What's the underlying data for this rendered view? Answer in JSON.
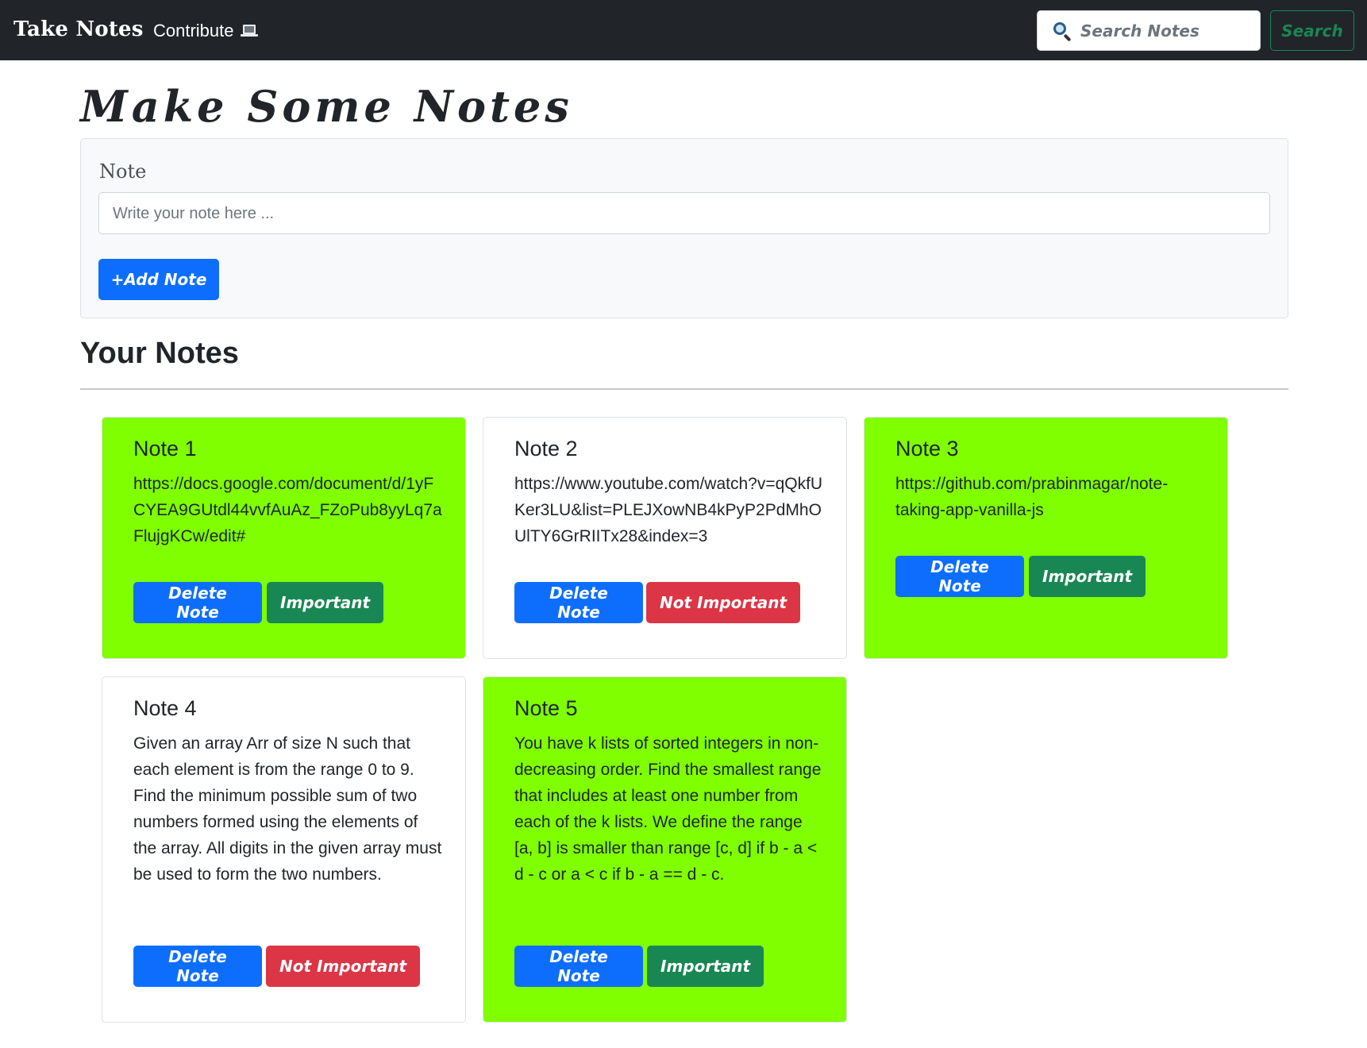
{
  "navbar": {
    "brand": "Take Notes",
    "contribute_label": "Contribute",
    "contribute_icon": "laptop-icon",
    "search_icon": "search-icon",
    "search_placeholder": "Search Notes",
    "search_button": "Search"
  },
  "main": {
    "title": "Make Some Notes",
    "form": {
      "label": "Note",
      "placeholder": "Write your note here ...",
      "add_button": "+Add Note"
    },
    "notes_heading": "Your Notes"
  },
  "notes": [
    {
      "title": "Note 1",
      "text": "https://docs.google.com/document/d/1yFCYEA9GUtdl44vvfAuAz_FZoPub8yyLq7aFlujgKCw/edit#",
      "important": true,
      "delete_label": "Delete Note",
      "toggle_label": "Important"
    },
    {
      "title": "Note 2",
      "text": "https://www.youtube.com/watch?v=qQkfUKer3LU&list=PLEJXowNB4kPyP2PdMhOUlTY6GrRIITx28&index=3",
      "important": false,
      "delete_label": "Delete Note",
      "toggle_label": "Not Important"
    },
    {
      "title": "Note 3",
      "text": "https://github.com/prabinmagar/note-taking-app-vanilla-js",
      "important": true,
      "delete_label": "Delete Note",
      "toggle_label": "Important"
    },
    {
      "title": "Note 4",
      "text": "Given an array Arr of size N such that each element is from the range 0 to 9. Find the minimum possible sum of two numbers formed using the elements of the array. All digits in the given array must be used to form the two numbers.",
      "important": false,
      "delete_label": "Delete Note",
      "toggle_label": "Not Important"
    },
    {
      "title": "Note 5",
      "text": "You have k lists of sorted integers in non-decreasing order. Find the smallest range that includes at least one number from each of the k lists. We define the range [a, b] is smaller than range [c, d] if b - a < d - c or a < c if b - a == d - c.",
      "important": true,
      "delete_label": "Delete Note",
      "toggle_label": "Important"
    }
  ],
  "colors": {
    "navbar_bg": "#212529",
    "important_bg": "#7fff00",
    "primary": "#0d6efd",
    "success": "#198754",
    "danger": "#dc3545"
  }
}
